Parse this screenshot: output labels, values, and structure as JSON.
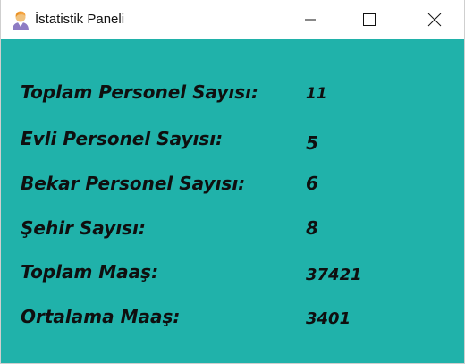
{
  "window": {
    "title": "İstatistik Paneli",
    "background_color": "#20b2aa",
    "icon": "user-avatar-icon"
  },
  "controls": {
    "minimize_icon": "minimize-icon",
    "maximize_icon": "maximize-icon",
    "close_icon": "close-icon"
  },
  "stats": [
    {
      "label": "Toplam Personel Sayısı:",
      "value": "11"
    },
    {
      "label": "Evli Personel Sayısı:",
      "value": "5"
    },
    {
      "label": "Bekar Personel Sayısı:",
      "value": "6"
    },
    {
      "label": "Şehir Sayısı:",
      "value": "8"
    },
    {
      "label": "Toplam Maaş:",
      "value": "37421"
    },
    {
      "label": "Ortalama Maaş:",
      "value": "3401"
    }
  ]
}
